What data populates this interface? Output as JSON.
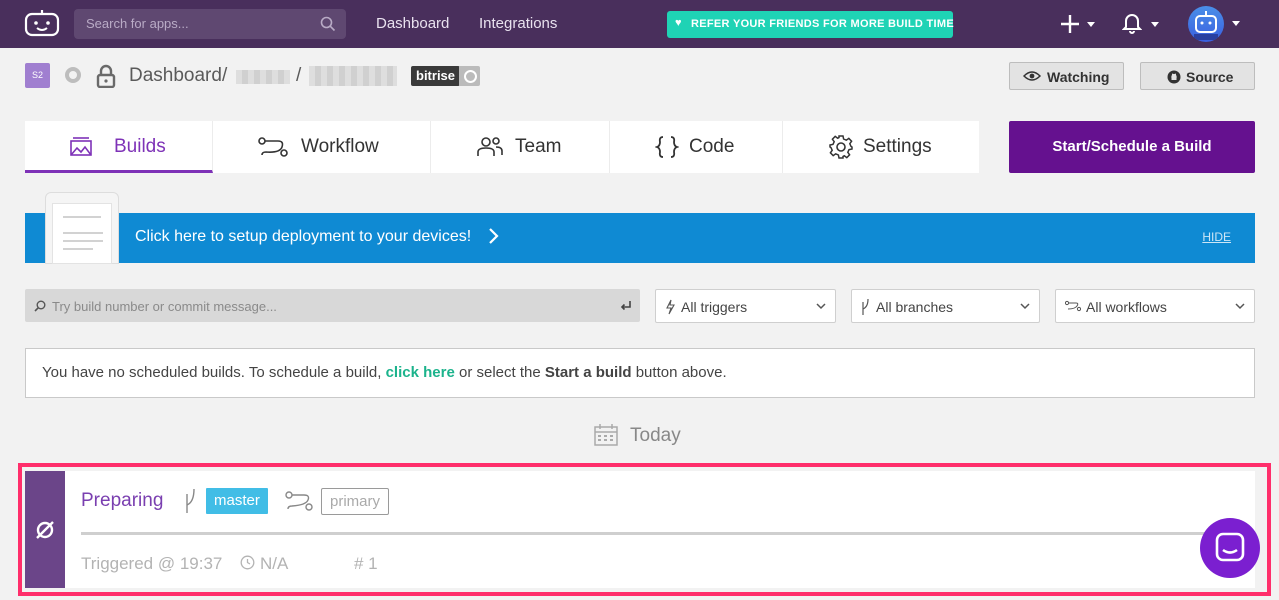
{
  "topbar": {
    "search_placeholder": "Search for apps...",
    "nav": [
      "Dashboard",
      "Integrations"
    ],
    "refer_prefix": "REFER YOUR FRIENDS FOR ",
    "refer_emphasis": "MORE BUILD TIME",
    "colors": {
      "bar": "#492f5c",
      "refer": "#1fd3b5"
    }
  },
  "app": {
    "badge": "S2",
    "breadcrumb_root": "Dashboard",
    "separator": "/",
    "tag": "bitrise",
    "watch_label": "Watching",
    "source_label": "Source"
  },
  "tabs": [
    {
      "label": "Builds",
      "icon": "builds-icon",
      "active": true
    },
    {
      "label": "Workflow",
      "icon": "workflow-icon"
    },
    {
      "label": "Team",
      "icon": "team-icon"
    },
    {
      "label": "Code",
      "icon": "code-icon"
    },
    {
      "label": "Settings",
      "icon": "settings-icon"
    }
  ],
  "start_button": "Start/Schedule a Build",
  "banner": {
    "text": "Click here to setup deployment to your devices!",
    "hide": "HIDE",
    "color": "#0f8ad3"
  },
  "filters": {
    "search_placeholder": "Try build number or commit message...",
    "triggers": "All triggers",
    "branches": "All branches",
    "workflows": "All workflows"
  },
  "notice": {
    "prefix": "You have no scheduled builds. To schedule a build, ",
    "link": "click here",
    "middle": " or select the ",
    "bold": "Start a build",
    "suffix": " button above."
  },
  "date_group": "Today",
  "build": {
    "status": "Preparing",
    "branch": "master",
    "workflow": "primary",
    "triggered": "Triggered @ 19:37",
    "duration": "N/A",
    "number": "# 1",
    "colors": {
      "strip": "#6b4589",
      "branch": "#41bde6",
      "highlight": "#ff2e6b"
    }
  }
}
